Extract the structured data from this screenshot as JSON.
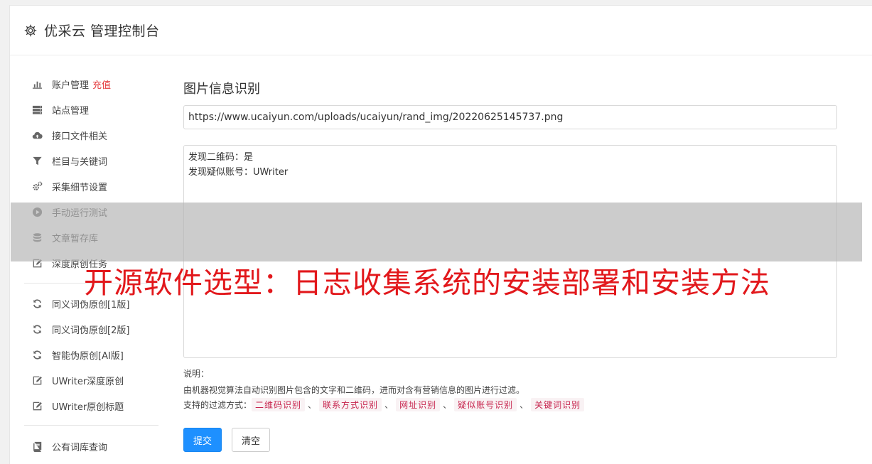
{
  "header": {
    "icon": "gear-icon",
    "title": "优采云 管理控制台"
  },
  "sidebar": {
    "items": [
      {
        "icon": "bar-chart-icon",
        "label": "账户管理",
        "badge": "充值"
      },
      {
        "icon": "server-icon",
        "label": "站点管理"
      },
      {
        "icon": "cloud-upload-icon",
        "label": "接口文件相关"
      },
      {
        "icon": "filter-icon",
        "label": "栏目与关键词"
      },
      {
        "icon": "gears-icon",
        "label": "采集细节设置"
      },
      {
        "icon": "play-circle-icon",
        "label": "手动运行测试"
      },
      {
        "icon": "database-icon",
        "label": "文章暂存库"
      },
      {
        "icon": "edit-icon",
        "label": "深度原创任务"
      },
      {
        "icon": "refresh-icon",
        "label": "同义词伪原创[1版]"
      },
      {
        "icon": "refresh-icon",
        "label": "同义词伪原创[2版]"
      },
      {
        "icon": "refresh-icon",
        "label": "智能伪原创[AI版]"
      },
      {
        "icon": "edit-icon",
        "label": "UWriter深度原创"
      },
      {
        "icon": "edit-icon",
        "label": "UWriter原创标题"
      },
      {
        "icon": "book-icon",
        "label": "公有词库查询"
      }
    ]
  },
  "main": {
    "title": "图片信息识别",
    "url_value": "https://www.ucaiyun.com/uploads/ucaiyun/rand_img/20220625145737.png",
    "result_lines": [
      "发现二维码：是",
      "发现疑似账号：UWriter"
    ],
    "desc_label": "说明：",
    "desc_text": "由机器视觉算法自动识别图片包含的文字和二维码，进而对含有营销信息的图片进行过滤。",
    "filter_label": "支持的过滤方式：",
    "filter_tags": [
      "二维码识别",
      "联系方式识别",
      "网址识别",
      "疑似账号识别",
      "关键词识别"
    ],
    "filter_sep": "、",
    "submit_label": "提交",
    "clear_label": "清空"
  },
  "overlay": {
    "headline": "开源软件选型：日志收集系统的安装部署和安装方法"
  },
  "colors": {
    "primary": "#1e90ff",
    "badge": "#e4393c",
    "tag_text": "#c7254e",
    "tag_bg": "#f9f2f4",
    "headline": "#e2181c"
  }
}
